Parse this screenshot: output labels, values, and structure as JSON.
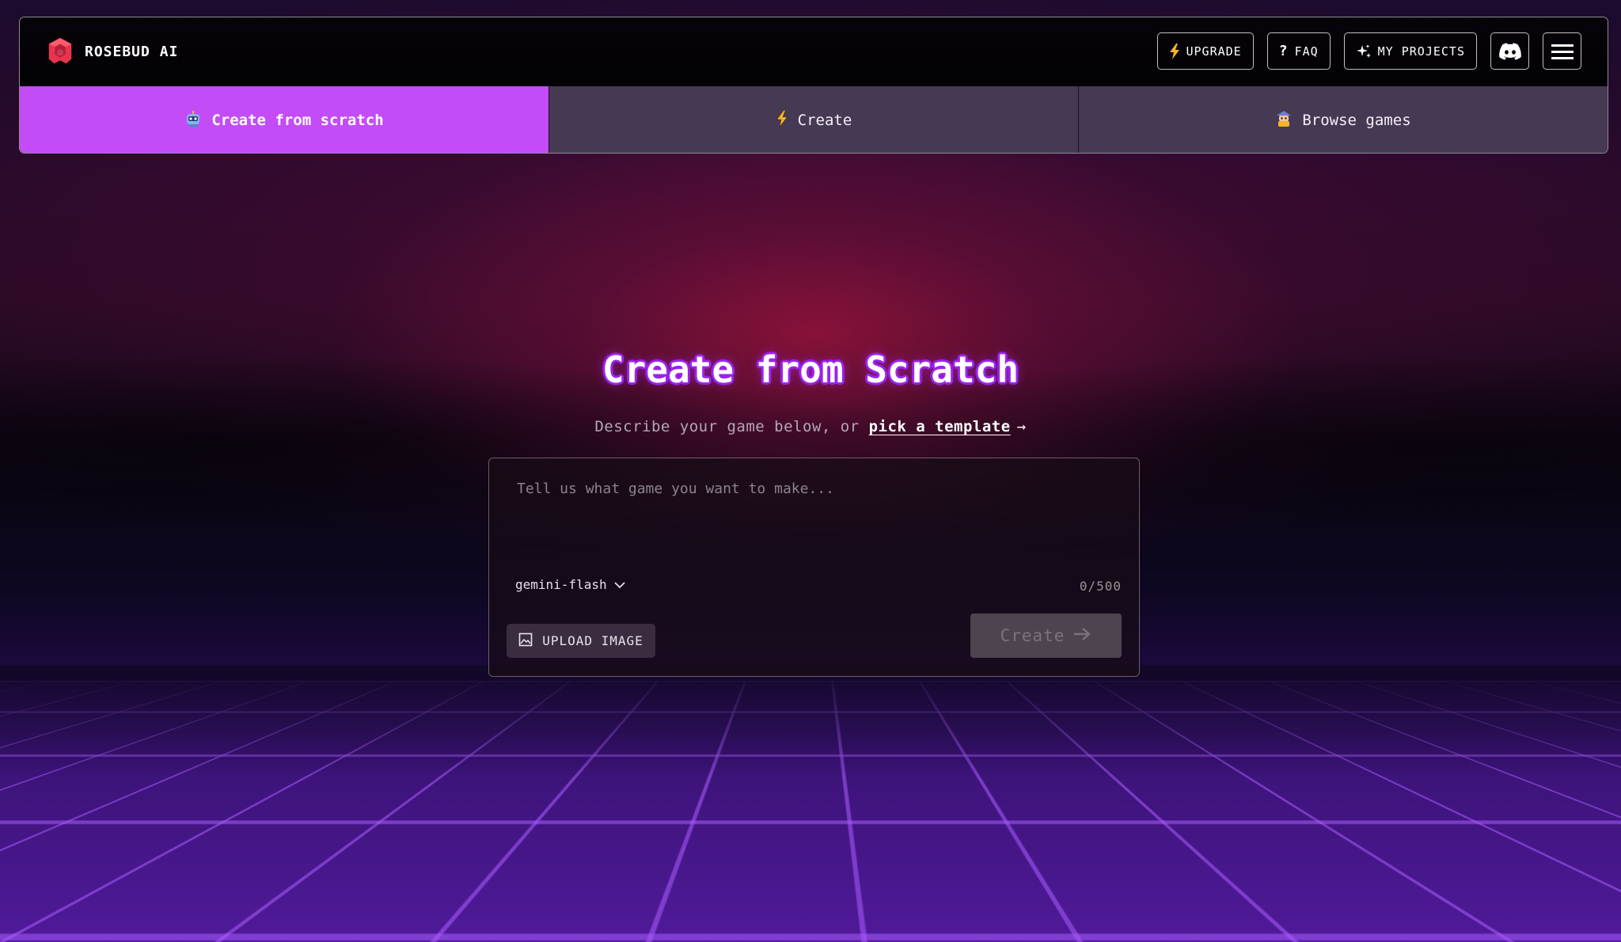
{
  "brand": {
    "name": "ROSEBUD AI",
    "logo_icon": "rosebud-logo-icon",
    "logo_color": "#e8344e"
  },
  "nav": {
    "upgrade_label": "UPGRADE",
    "faq_label": "FAQ",
    "my_projects_label": "MY PROJECTS",
    "discord_icon": "discord-icon",
    "menu_icon": "hamburger-menu-icon"
  },
  "tabs": [
    {
      "label": "Create from scratch",
      "icon": "robot-icon",
      "active": true
    },
    {
      "label": "Create",
      "icon": "lightning-icon",
      "active": false
    },
    {
      "label": "Browse games",
      "icon": "game-character-icon",
      "active": false
    }
  ],
  "hero": {
    "title": "Create from Scratch",
    "subtitle_prefix": "Describe your game below, or",
    "subtitle_link": "pick a template"
  },
  "prompt": {
    "placeholder": "Tell us what game you want to make...",
    "value": "",
    "model": "gemini-flash",
    "counter": "0/500",
    "upload_label": "UPLOAD IMAGE",
    "create_label": "Create"
  },
  "colors": {
    "accent": "#c34cf8",
    "tab_inactive": "#463954",
    "title_glow": "#9b22ee"
  }
}
